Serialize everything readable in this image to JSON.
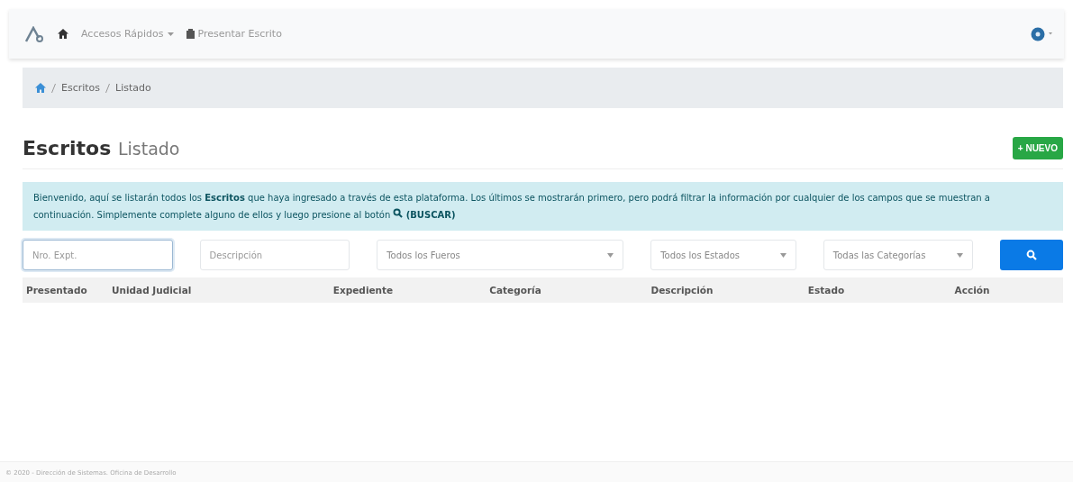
{
  "navbar": {
    "links": [
      {
        "kind": "dropdown",
        "label": "Accesos Rápidos"
      },
      {
        "kind": "link",
        "label": "Presentar Escrito"
      }
    ]
  },
  "breadcrumb": [
    "Escritos",
    "Listado"
  ],
  "header": {
    "title": "Escritos",
    "subtitle": "Listado",
    "new_button": "+ NUEVO"
  },
  "alert": {
    "text": "Bienvenido, aquí se listarán todos los **Escritos** que haya ingresado a través de esta plataforma. Los últimos se mostrarán primero, pero podrá filtrar la información por cualquier de los campos que se muestran a continuación. Simplemente complete alguno de ellos y luego presione al botón",
    "button_ref": "(BUSCAR)"
  },
  "filters": [
    {
      "kind": "input",
      "placeholder": "Nro. Expt.",
      "focused": true
    },
    {
      "kind": "input",
      "placeholder": "Descripción",
      "focused": false
    },
    {
      "kind": "select",
      "value": "Todos los Fueros",
      "focused": false
    },
    {
      "kind": "select",
      "value": "Todos los Estados",
      "focused": false
    },
    {
      "kind": "select",
      "value": "Todas las Categorías",
      "focused": false
    }
  ],
  "table": {
    "columns": [
      "Presentado",
      "Unidad Judicial",
      "Expediente",
      "Categoría",
      "Descripción",
      "Estado",
      "Acción"
    ]
  },
  "footer": "© 2020 - Dirección de Sistemas. Oficina de Desarrollo"
}
